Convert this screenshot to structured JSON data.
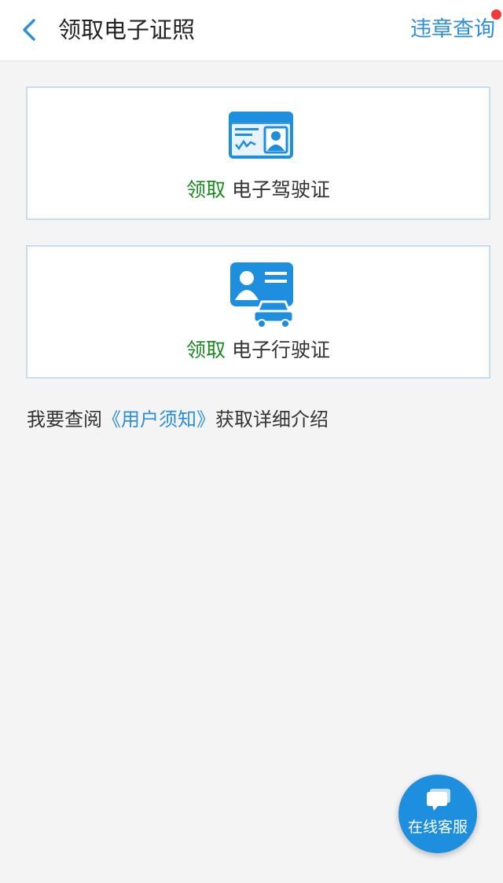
{
  "header": {
    "title": "领取电子证照",
    "right_link": "违章查询"
  },
  "cards": [
    {
      "action": "领取",
      "name": "电子驾驶证",
      "icon": "driver-license-icon"
    },
    {
      "action": "领取",
      "name": "电子行驶证",
      "icon": "vehicle-license-icon"
    }
  ],
  "notice": {
    "prefix": "我要查阅",
    "link": "《用户须知》",
    "suffix": "获取详细介绍"
  },
  "fab": {
    "label": "在线客服",
    "icon": "chat-icon"
  },
  "colors": {
    "accent_blue": "#2d8fd9",
    "action_green": "#1b8a22",
    "badge_red": "#f23a3a",
    "fab_blue": "#1e8ede"
  }
}
